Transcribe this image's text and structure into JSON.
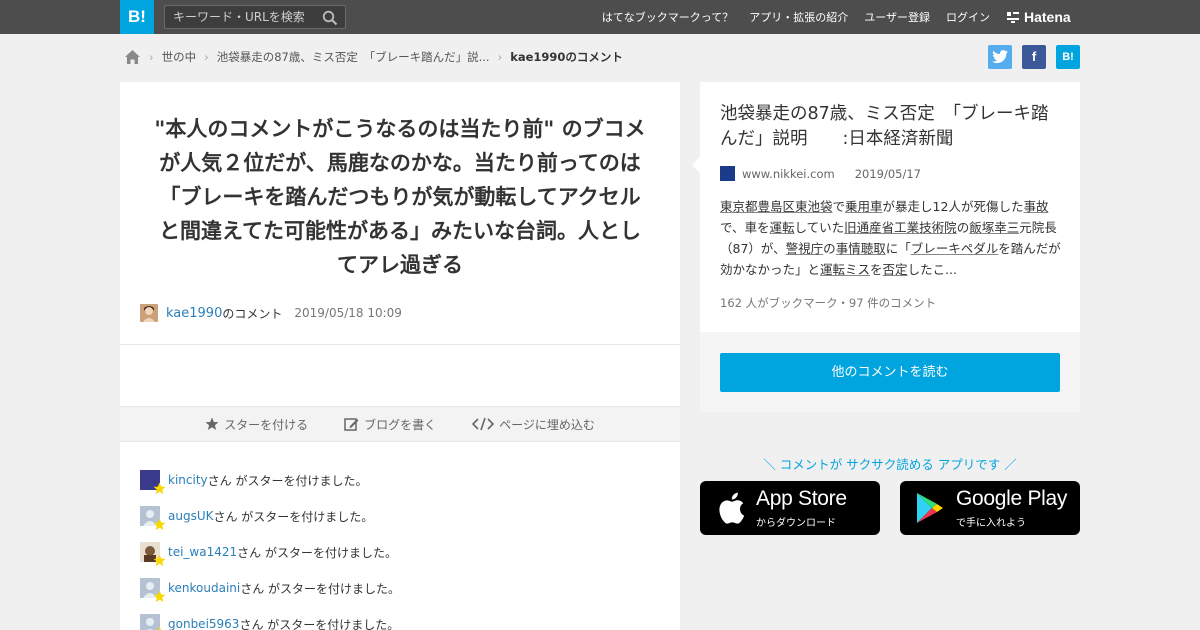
{
  "topbar": {
    "logo": "B!",
    "search_placeholder": "キーワード・URLを検索",
    "nav": [
      "はてなブックマークって？",
      "アプリ・拡張の紹介",
      "ユーザー登録",
      "ログイン"
    ],
    "hatena_logo": "Hatena"
  },
  "breadcrumb": {
    "items": [
      "世の中",
      "池袋暴走の87歳、ミス否定　「ブレーキ踏んだ」説..."
    ],
    "current": "kae1990のコメント"
  },
  "share": {
    "twitter": "t",
    "facebook": "f",
    "hatebu": "B!"
  },
  "comment": {
    "text": "\"本人のコメントがこうなるのは当たり前\" のブコメが人気２位だが、馬鹿なのかな。当たり前ってのは「ブレーキを踏んだつもりが気が動転してアクセルと間違えてた可能性がある」みたいな台詞。人としてアレ過ぎる",
    "user": "kae1990",
    "user_suffix": "のコメント",
    "date": "2019/05/18 10:09"
  },
  "actions": {
    "star": "スターを付ける",
    "blog": "ブログを書く",
    "embed": "ページに埋め込む"
  },
  "stars": [
    {
      "user": "kincity",
      "suffix": "さん がスターを付けました。",
      "avatar_color": "#3a3a8c"
    },
    {
      "user": "augsUK",
      "suffix": "さん がスターを付けました。",
      "avatar_color": "#a8b8cc"
    },
    {
      "user": "tei_wa1421",
      "suffix": "さん がスターを付けました。",
      "avatar_color": "#7a5a3a"
    },
    {
      "user": "kenkoudaini",
      "suffix": "さん がスターを付けました。",
      "avatar_color": "#a8b8cc"
    },
    {
      "user": "gonbei5963",
      "suffix": "さん がスターを付けました。",
      "avatar_color": "#a8b8cc"
    }
  ],
  "entry": {
    "title": "池袋暴走の87歳、ミス否定　「ブレーキ踏んだ」説明　　:日本経済新聞",
    "site": "www.nikkei.com",
    "date": "2019/05/17",
    "summary_parts": [
      {
        "t": "東京都豊島区東池袋",
        "kw": true
      },
      {
        "t": "で",
        "kw": false
      },
      {
        "t": "乗用車",
        "kw": true
      },
      {
        "t": "が暴走し12人が死傷した",
        "kw": false
      },
      {
        "t": "事故",
        "kw": true
      },
      {
        "t": "で、車を",
        "kw": false
      },
      {
        "t": "運転",
        "kw": true
      },
      {
        "t": "していた",
        "kw": false
      },
      {
        "t": "旧通産省工業技術院",
        "kw": true
      },
      {
        "t": "の",
        "kw": false
      },
      {
        "t": "飯塚幸三",
        "kw": true
      },
      {
        "t": "元院長（87）が、",
        "kw": false
      },
      {
        "t": "警視庁",
        "kw": true
      },
      {
        "t": "の",
        "kw": false
      },
      {
        "t": "事情聴取",
        "kw": true
      },
      {
        "t": "に「",
        "kw": false
      },
      {
        "t": "ブレーキペダル",
        "kw": true
      },
      {
        "t": "を踏んだが効かなかった」と",
        "kw": false
      },
      {
        "t": "運転ミス",
        "kw": true
      },
      {
        "t": "を",
        "kw": false
      },
      {
        "t": "否定",
        "kw": true
      },
      {
        "t": "したこ...",
        "kw": false
      }
    ],
    "count": "162 人がブックマーク・97 件のコメント",
    "read_button": "他のコメントを読む"
  },
  "app": {
    "promo": "＼ コメントが サクサク読める アプリです ／",
    "appstore_big": "App Store",
    "appstore_small": "からダウンロード",
    "gplay_big": "Google Play",
    "gplay_small": "で手に入れよう"
  },
  "colors": {
    "accent": "#00a4de",
    "topbar": "#4d4d4d",
    "star": "#f5d800"
  }
}
